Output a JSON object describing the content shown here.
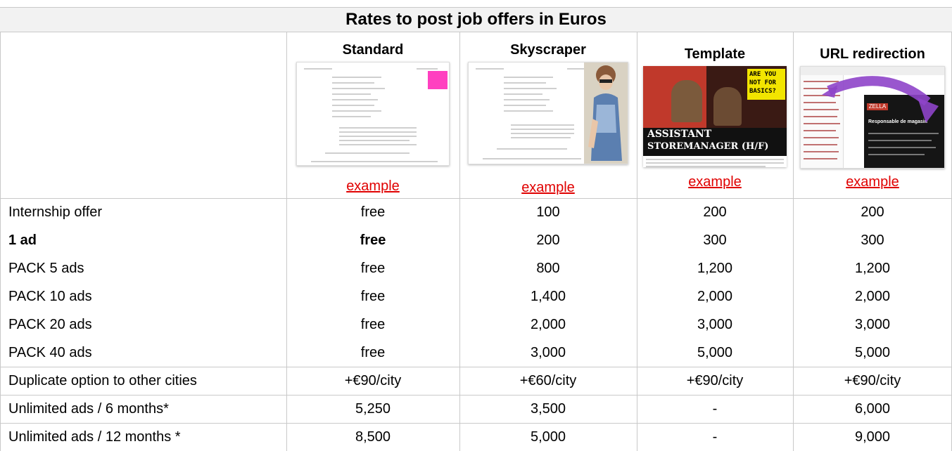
{
  "title": "Rates to post job offers in Euros",
  "columns": [
    "Standard",
    "Skyscraper",
    "Template",
    "URL redirection"
  ],
  "example_label": "example",
  "template_thumb": {
    "banner_lines": [
      "ARE YOU",
      "NOT FOR",
      "BASICS?"
    ],
    "title_lines": [
      "ASSISTANT",
      "STOREMANAGER (H/F)"
    ]
  },
  "url_thumb": {
    "tag": "ZELLA",
    "heading": "Responsable de magasin"
  },
  "rows": [
    {
      "label": "Internship offer",
      "values": [
        "free",
        "100",
        "200",
        "200"
      ],
      "bold": false
    },
    {
      "label": "1 ad",
      "values": [
        "free",
        "200",
        "300",
        "300"
      ],
      "bold": true
    },
    {
      "label": "PACK 5 ads",
      "values": [
        "free",
        "800",
        "1,200",
        "1,200"
      ],
      "bold": false
    },
    {
      "label": "PACK 10 ads",
      "values": [
        "free",
        "1,400",
        "2,000",
        "2,000"
      ],
      "bold": false
    },
    {
      "label": "PACK 20 ads",
      "values": [
        "free",
        "2,000",
        "3,000",
        "3,000"
      ],
      "bold": false
    },
    {
      "label": "PACK 40 ads",
      "values": [
        "free",
        "3,000",
        "5,000",
        "5,000"
      ],
      "bold": false
    },
    {
      "label": "Duplicate option to other cities",
      "values": [
        "+€90/city",
        "+€60/city",
        "+€90/city",
        "+€90/city"
      ],
      "bold": false
    },
    {
      "label": "Unlimited ads / 6 months*",
      "values": [
        "5,250",
        "3,500",
        "-",
        "6,000"
      ],
      "bold": false
    },
    {
      "label": "Unlimited ads / 12 months *",
      "values": [
        "8,500",
        "5,000",
        "-",
        "9,000"
      ],
      "bold": false
    }
  ]
}
